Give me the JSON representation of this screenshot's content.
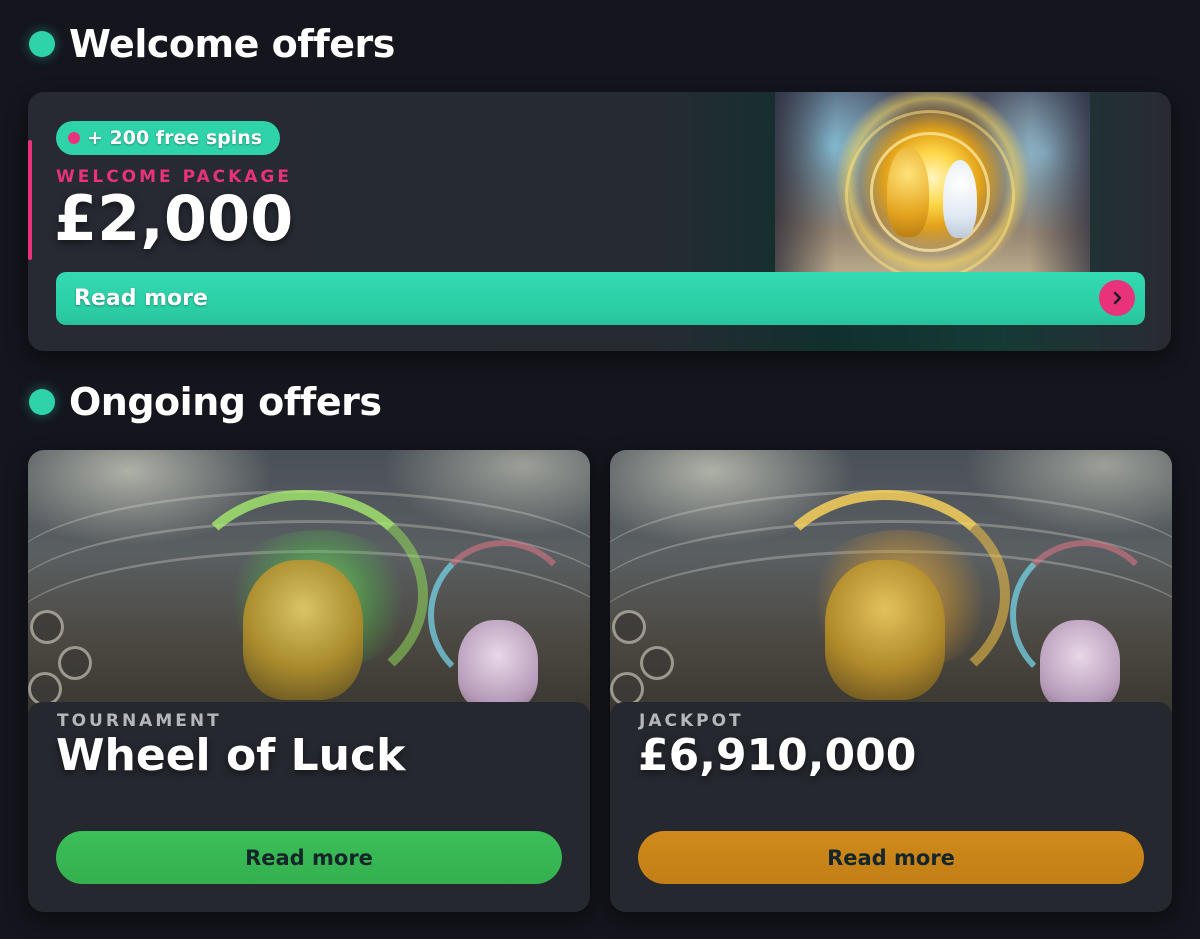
{
  "welcome_section": {
    "title": "Welcome offers",
    "card": {
      "badge": "+ 200 free spins",
      "eyebrow": "WELCOME PACKAGE",
      "amount": "£2,000",
      "button_label": "Read more"
    }
  },
  "ongoing_section": {
    "title": "Ongoing offers",
    "cards": [
      {
        "eyebrow": "TOURNAMENT",
        "title": "Wheel of Luck",
        "button_label": "Read more",
        "button_color": "#35b24f"
      },
      {
        "eyebrow": "JACKPOT",
        "title": "£6,910,000",
        "button_label": "Read more",
        "button_color": "#c98418"
      }
    ]
  },
  "colors": {
    "background": "#14151d",
    "card": "#262830",
    "accent_teal": "#2fd3aa",
    "accent_pink": "#e8327a"
  },
  "icons": {
    "section_marker": "teal-dot-icon",
    "badge_marker": "pink-dot-icon",
    "arrow": "chevron-right-icon"
  }
}
